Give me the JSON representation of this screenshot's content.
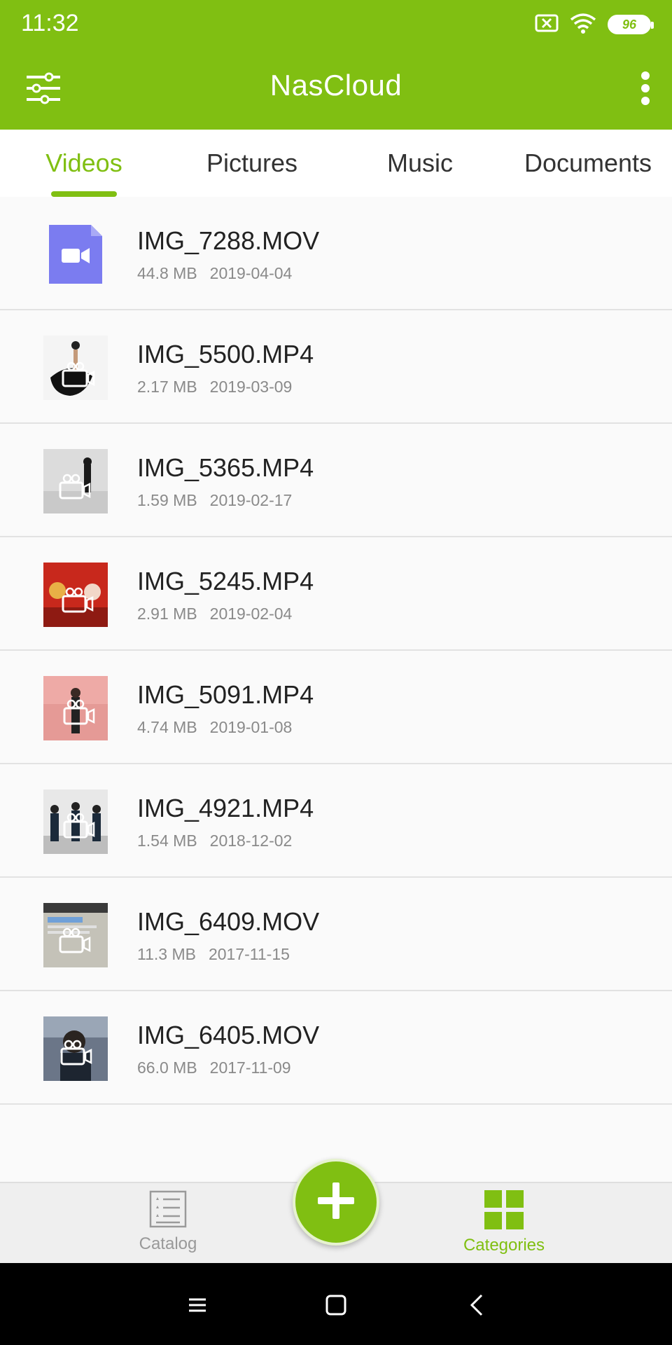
{
  "status_bar": {
    "time": "11:32",
    "battery": "96",
    "icons": [
      "sim-error-icon",
      "wifi-icon",
      "battery-icon"
    ]
  },
  "app_bar": {
    "title": "NasCloud",
    "left_icon": "filter-sliders-icon",
    "right_icon": "more-vertical-icon"
  },
  "tabs": [
    {
      "label": "Videos",
      "active": true
    },
    {
      "label": "Pictures",
      "active": false
    },
    {
      "label": "Music",
      "active": false
    },
    {
      "label": "Documents",
      "active": false
    }
  ],
  "files": [
    {
      "name": "IMG_7288.MOV",
      "size": "44.8 MB",
      "date": "2019-04-04"
    },
    {
      "name": "IMG_5500.MP4",
      "size": "2.17 MB",
      "date": "2019-03-09"
    },
    {
      "name": "IMG_5365.MP4",
      "size": "1.59 MB",
      "date": "2019-02-17"
    },
    {
      "name": "IMG_5245.MP4",
      "size": "2.91 MB",
      "date": "2019-02-04"
    },
    {
      "name": "IMG_5091.MP4",
      "size": "4.74 MB",
      "date": "2019-01-08"
    },
    {
      "name": "IMG_4921.MP4",
      "size": "1.54 MB",
      "date": "2018-12-02"
    },
    {
      "name": "IMG_6409.MOV",
      "size": "11.3 MB",
      "date": "2017-11-15"
    },
    {
      "name": "IMG_6405.MOV",
      "size": "66.0 MB",
      "date": "2017-11-09"
    }
  ],
  "bottom_nav": {
    "catalog": "Catalog",
    "categories": "Categories",
    "fab_icon": "plus-icon"
  },
  "colors": {
    "accent": "#80bf12",
    "video_icon": "#7b7cf0",
    "meta_text": "#8a8a8a"
  }
}
